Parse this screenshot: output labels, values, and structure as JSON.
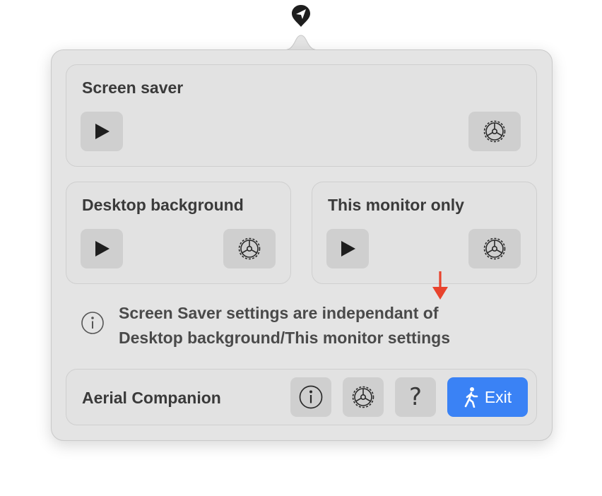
{
  "screen_saver": {
    "title": "Screen saver"
  },
  "desktop_background": {
    "title": "Desktop background"
  },
  "monitor_only": {
    "title": "This monitor only"
  },
  "info": {
    "line1": "Screen Saver settings are independant of",
    "line2": "Desktop background/This monitor settings"
  },
  "footer": {
    "app_name": "Aerial Companion",
    "help_label": "?",
    "exit_label": "Exit"
  },
  "colors": {
    "accent": "#3a82f5",
    "annotation_arrow": "#e8432d"
  },
  "icons": {
    "menubar": "aerial-logo-icon",
    "play": "play-icon",
    "settings": "gear-icon",
    "info": "info-icon",
    "help": "question-icon",
    "exit": "walking-person-icon"
  }
}
